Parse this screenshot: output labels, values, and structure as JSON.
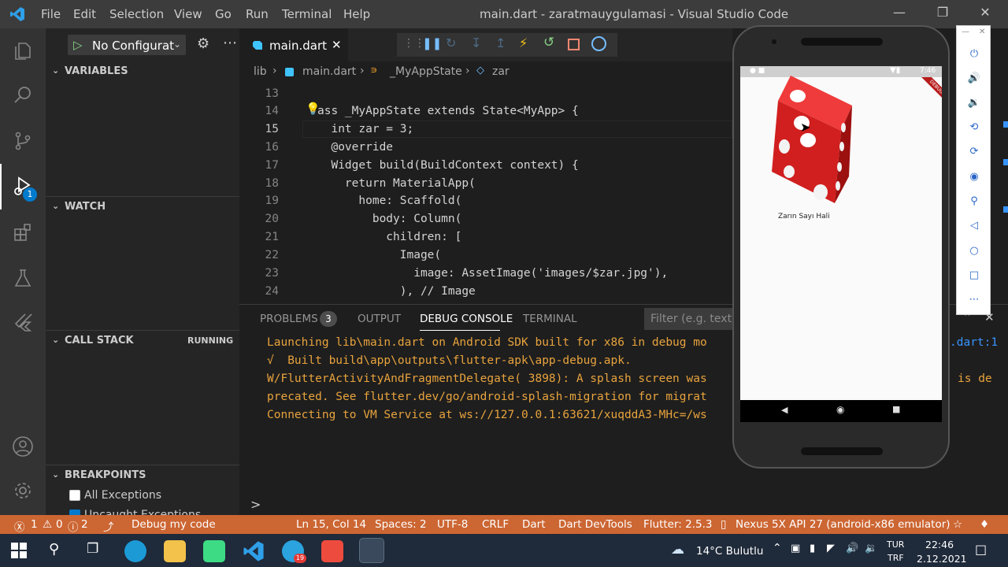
{
  "window": {
    "title": "main.dart - zaratmauygulamasi - Visual Studio Code"
  },
  "menu": [
    "File",
    "Edit",
    "Selection",
    "View",
    "Go",
    "Run",
    "Terminal",
    "Help"
  ],
  "activity_badge": "1",
  "debug": {
    "config_label": "No Configurat"
  },
  "sidebar": {
    "variables": "VARIABLES",
    "watch": "WATCH",
    "call_stack": "CALL STACK",
    "call_stack_status": "RUNNING",
    "breakpoints": "BREAKPOINTS",
    "all_exceptions": "All Exceptions",
    "uncaught_exceptions": "Uncaught Exceptions"
  },
  "editor": {
    "tab": "main.dart",
    "breadcrumb": [
      "lib",
      "main.dart",
      "_MyAppState",
      "zar"
    ],
    "lines": [
      {
        "n": "13",
        "t": ""
      },
      {
        "n": "14",
        "t": "ass _MyAppState extends State<MyApp> {"
      },
      {
        "n": "15",
        "t": "  int zar = 3;"
      },
      {
        "n": "16",
        "t": "  @override"
      },
      {
        "n": "17",
        "t": "  Widget build(BuildContext context) {"
      },
      {
        "n": "18",
        "t": "    return MaterialApp("
      },
      {
        "n": "19",
        "t": "      home: Scaffold("
      },
      {
        "n": "20",
        "t": "        body: Column("
      },
      {
        "n": "21",
        "t": "          children: ["
      },
      {
        "n": "22",
        "t": "            Image("
      },
      {
        "n": "23",
        "t": "              image: AssetImage('images/$zar.jpg'),"
      },
      {
        "n": "24",
        "t": "            ), // Image"
      }
    ]
  },
  "panel": {
    "tabs": [
      "PROBLEMS",
      "OUTPUT",
      "DEBUG CONSOLE",
      "TERMINAL"
    ],
    "problems_count": "3",
    "filter_placeholder": "Filter (e.g. text, !e",
    "console": [
      "Launching lib\\main.dart on Android SDK built for x86 in debug mo",
      "√  Built build\\app\\outputs\\flutter-apk\\app-debug.apk.",
      "W/FlutterActivityAndFragmentDelegate( 3898): A splash screen was",
      "precated. See flutter.dev/go/android-splash-migration for migrat",
      "Connecting to VM Service at ws://127.0.0.1:63621/xuqddA3-MHc=/ws"
    ],
    "right_link": ".dart:1",
    "right_text": "is de",
    "prompt": ">"
  },
  "statusbar": {
    "errors": "1",
    "warnings": "0",
    "infos": "2",
    "debug_label": "Debug my code",
    "position": "Ln 15, Col 14",
    "spaces": "Spaces: 2",
    "encoding": "UTF-8",
    "eol": "CRLF",
    "language": "Dart",
    "devtools": "Dart DevTools",
    "flutter": "Flutter: 2.5.3",
    "device": "Nexus 5X API 27 (android-x86 emulator)"
  },
  "phone": {
    "time": "7:46",
    "caption": "Zarın Sayı Hali",
    "debug_banner": "DEBUG",
    "dice_value": 3
  },
  "taskbar": {
    "weather": "14°C Bulutlu",
    "lang1": "TUR",
    "lang2": "TRF",
    "time": "22:46",
    "date": "2.12.2021",
    "telegram_badge": "19"
  },
  "colors": {
    "statusbar": "#cc6633",
    "accent": "#007acc",
    "console_text": "#e8a33d",
    "dice_red": "#d11f1f"
  }
}
